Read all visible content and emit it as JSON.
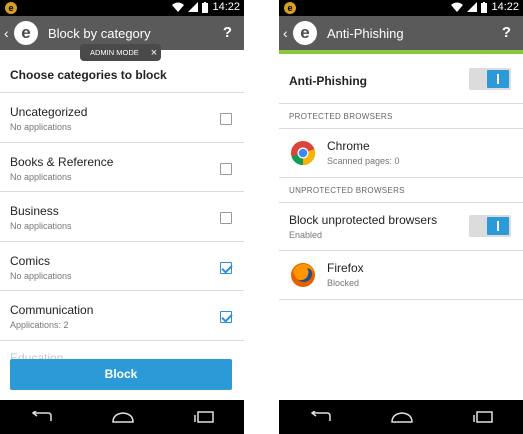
{
  "status": {
    "time": "14:22"
  },
  "screen1": {
    "title": "Block by category",
    "admin_badge": "ADMIN MODE",
    "admin_close": "×",
    "help": "?",
    "heading": "Choose categories to block",
    "categories": [
      {
        "name": "Uncategorized",
        "sub": "No applications",
        "checked": false
      },
      {
        "name": "Books & Reference",
        "sub": "No applications",
        "checked": false
      },
      {
        "name": "Business",
        "sub": "No applications",
        "checked": false
      },
      {
        "name": "Comics",
        "sub": "No applications",
        "checked": true
      },
      {
        "name": "Communication",
        "sub": "Applications: 2",
        "checked": true
      }
    ],
    "faded_item": "Education",
    "block_button": "Block"
  },
  "screen2": {
    "title": "Anti-Phishing",
    "help": "?",
    "main_toggle_label": "Anti-Phishing",
    "main_toggle_on": true,
    "protected_header": "PROTECTED BROWSERS",
    "protected": [
      {
        "name": "Chrome",
        "sub": "Scanned pages: 0",
        "icon": "chrome-icon"
      }
    ],
    "unprotected_header": "UNPROTECTED BROWSERS",
    "block_unprotected_label": "Block unprotected browsers",
    "block_unprotected_sub": "Enabled",
    "block_unprotected_on": true,
    "unprotected": [
      {
        "name": "Firefox",
        "sub": "Blocked",
        "icon": "firefox-icon"
      }
    ]
  },
  "colors": {
    "accent_green": "#8cc63f",
    "primary_blue": "#2d9ad8",
    "appbar": "#5a5a5a"
  }
}
